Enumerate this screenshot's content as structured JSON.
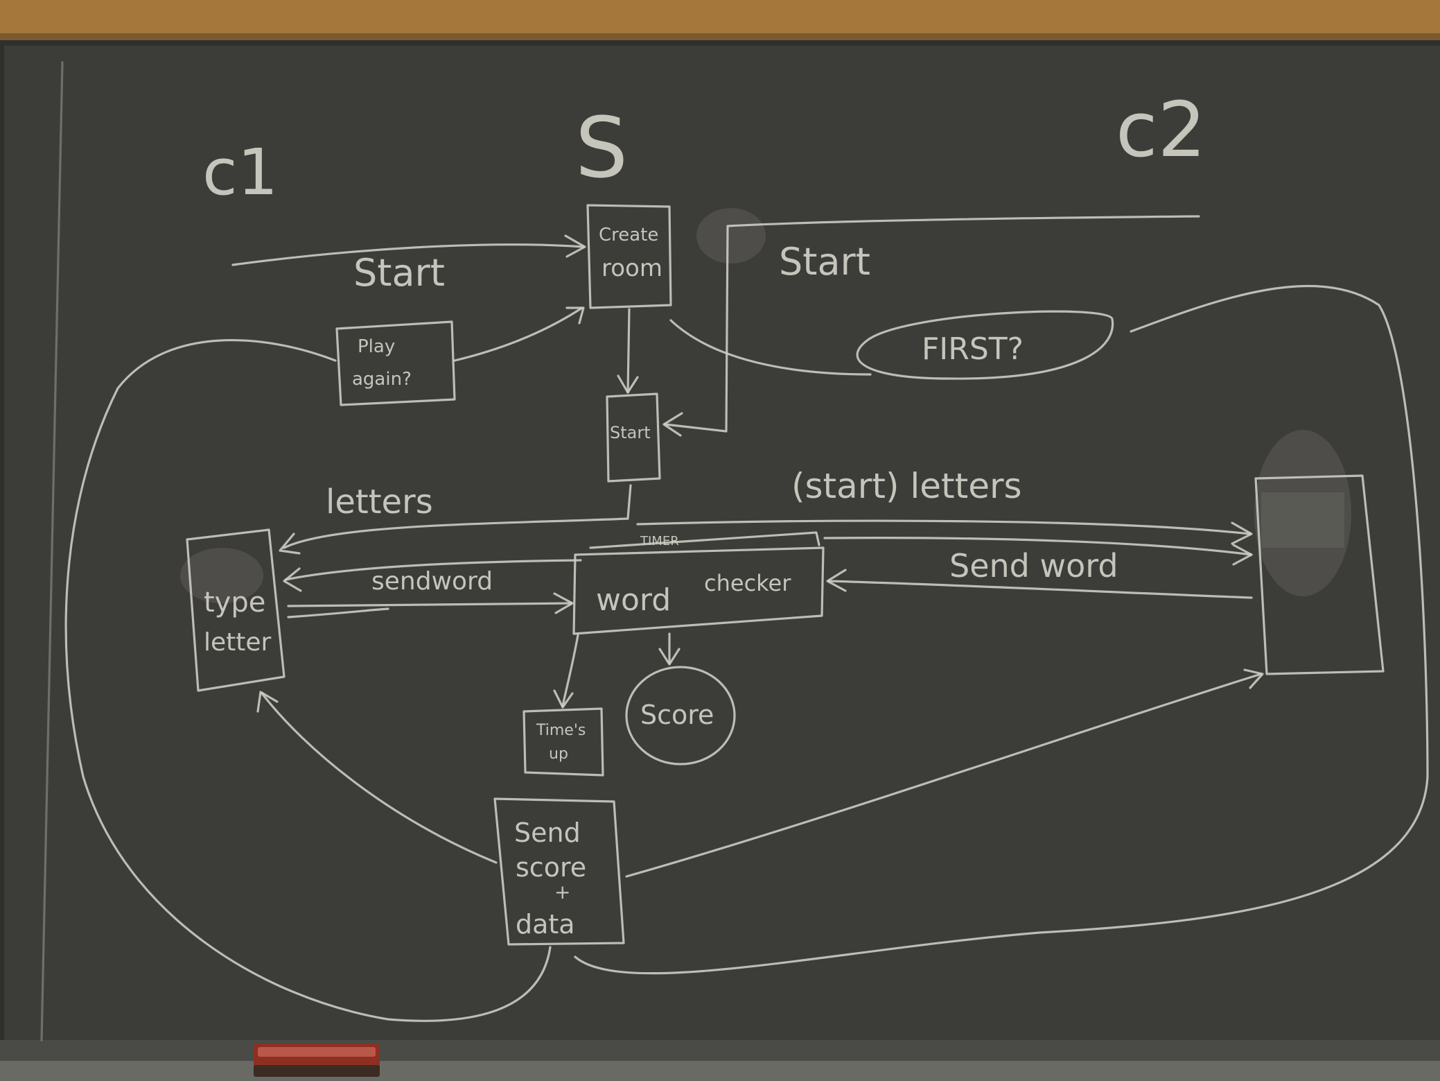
{
  "lanes": {
    "client1": "c1",
    "server": "S",
    "client2": "c2"
  },
  "boxes": {
    "create_room": [
      "Create",
      "room"
    ],
    "play_again": [
      "Play",
      "again?"
    ],
    "start": "Start",
    "type_letter": [
      "type",
      "letter"
    ],
    "word_checker": [
      "word",
      "checker"
    ],
    "timer": "TIMER",
    "score": "Score",
    "times_up": [
      "Time's",
      "up"
    ],
    "send_score": [
      "Send",
      "score",
      "+",
      "data"
    ],
    "first_ready": "FIRST?"
  },
  "arrow_labels": {
    "start_c1": "Start",
    "start_c2": "Start",
    "letters_c1": "letters",
    "letters_c2": "(start) letters",
    "sendword_c1": "sendword",
    "sendword_c2": "Send word"
  },
  "colors": {
    "board": "#3c3c39",
    "chalk": "#cfcfc6",
    "wood": "#a5773a"
  }
}
